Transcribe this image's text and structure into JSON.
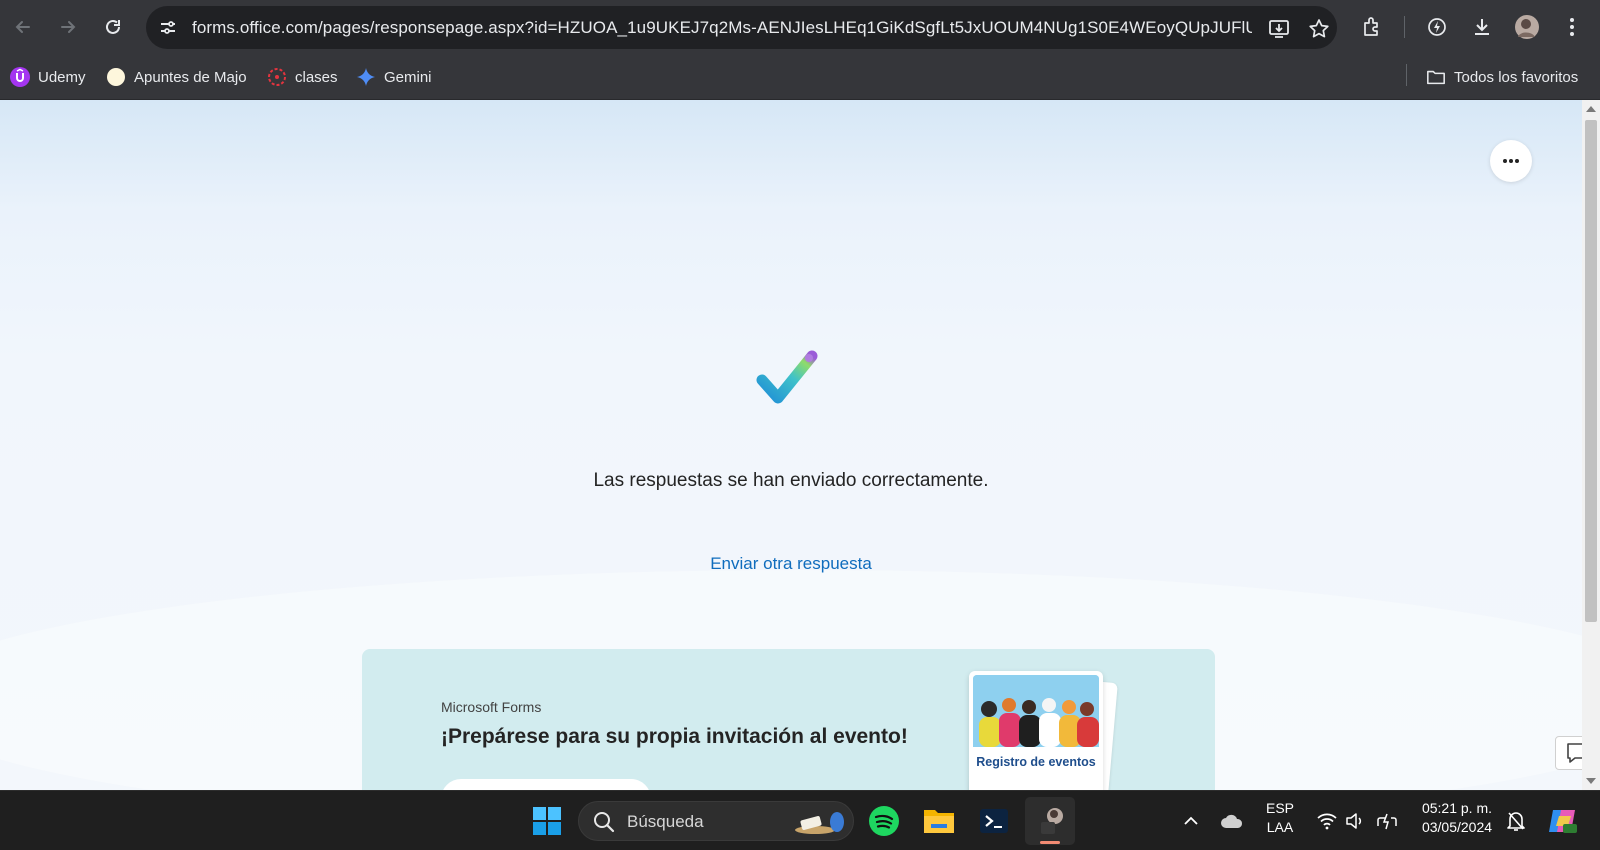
{
  "browser": {
    "url": "forms.office.com/pages/responsepage.aspx?id=HZUOA_1u9UKEJ7q2Ms-AENJIesLHEq1GiKdSgfLt5JxUOUM4NUg1S0E4WEoyQUpJUFlU...",
    "bookmarks": [
      {
        "label": "Udemy",
        "icon": "udemy-icon"
      },
      {
        "label": "Apuntes de Majo",
        "icon": "circle-icon"
      },
      {
        "label": "clases",
        "icon": "clases-icon"
      },
      {
        "label": "Gemini",
        "icon": "gemini-icon"
      }
    ],
    "all_bookmarks_label": "Todos los favoritos"
  },
  "page": {
    "success_message": "Las respuestas se han enviado correctamente.",
    "send_another_link": "Enviar otra respuesta",
    "promo": {
      "brand": "Microsoft Forms",
      "headline": "¡Prepárese para su propia invitación al evento!",
      "card_title": "Registro de eventos"
    }
  },
  "taskbar": {
    "search_placeholder": "Búsqueda",
    "language_line1": "ESP",
    "language_line2": "LAA",
    "time": "05:21 p. m.",
    "date": "03/05/2024"
  },
  "colors": {
    "link": "#0f6cbd",
    "promo_bg": "#d2ecef",
    "browser_chrome": "#35363a",
    "taskbar": "#1f1f1f"
  }
}
